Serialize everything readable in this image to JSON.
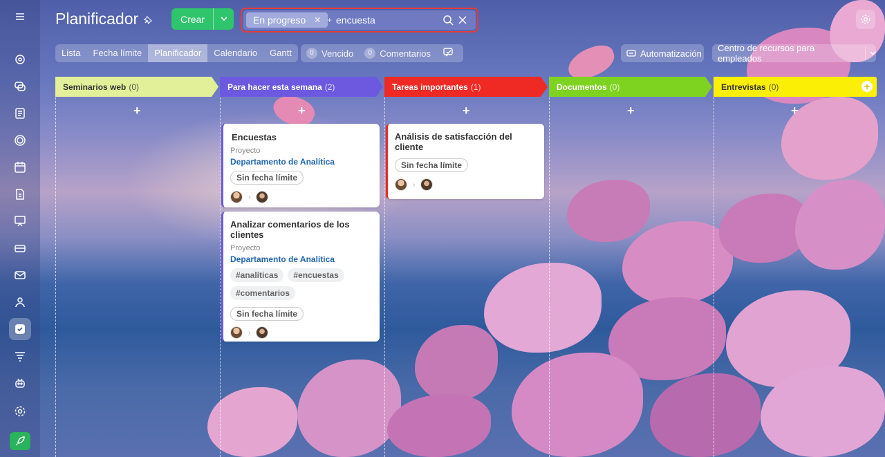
{
  "page": {
    "title": "Planificador"
  },
  "toolbar": {
    "create_label": "Crear"
  },
  "search": {
    "filter_chip": "En progreso",
    "query": "encuesta"
  },
  "views": {
    "tabs": [
      {
        "label": "Lista",
        "active": false
      },
      {
        "label": "Fecha límite",
        "active": false
      },
      {
        "label": "Planificador",
        "active": true
      },
      {
        "label": "Calendario",
        "active": false
      },
      {
        "label": "Gantt",
        "active": false
      }
    ]
  },
  "counters": {
    "overdue": {
      "count": "0",
      "label": "Vencido"
    },
    "comments": {
      "count": "0",
      "label": "Comentarios"
    }
  },
  "actions": {
    "automation_label": "Automatización",
    "resource_center_label": "Centro de recursos para empleados"
  },
  "columns": [
    {
      "title": "Seminarios web",
      "count": "(0)",
      "color": "#e2f09a",
      "text_color": "#333333"
    },
    {
      "title": "Para hacer esta semana",
      "count": "(2)",
      "color": "#6c59e0",
      "text_color": "#ffffff"
    },
    {
      "title": "Tareas importantes",
      "count": "(1)",
      "color": "#ef2a24",
      "text_color": "#ffffff"
    },
    {
      "title": "Documentos",
      "count": "(0)",
      "color": "#7ed321",
      "text_color": "#ffffff"
    },
    {
      "title": "Entrevistas",
      "count": "(0)",
      "color": "#fbef06",
      "text_color": "#333333"
    }
  ],
  "cards": {
    "c1": {
      "title": "Encuestas",
      "project_label": "Proyecto",
      "project": "Departamento de Analítica",
      "deadline": "Sin fecha límite"
    },
    "c2": {
      "title": "Analizar comentarios de los clientes",
      "project_label": "Proyecto",
      "project": "Departamento de Analítica",
      "tags": [
        "#analíticas",
        "#encuestas",
        "#comentarios"
      ],
      "deadline": "Sin fecha límite"
    },
    "c3": {
      "title": "Análisis de satisfacción del cliente",
      "deadline": "Sin fecha límite"
    }
  }
}
